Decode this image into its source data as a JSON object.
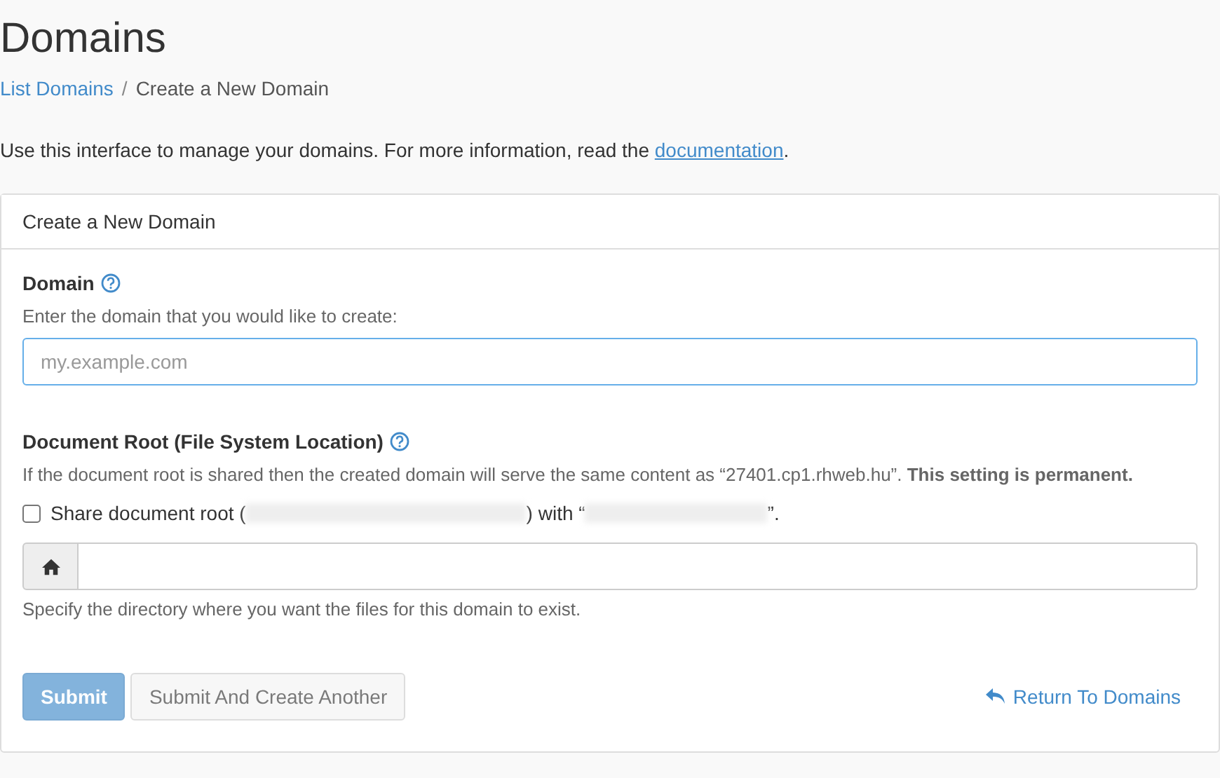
{
  "page": {
    "title": "Domains"
  },
  "breadcrumb_separator": "/",
  "breadcrumb": [
    {
      "label": "List Domains",
      "link": true
    },
    {
      "label": "Create a New Domain",
      "link": false
    }
  ],
  "intro": {
    "text": "Use this interface to manage your domains. For more information, read the ",
    "link": "documentation",
    "end": "."
  },
  "card": {
    "title": "Create a New Domain"
  },
  "domain_field": {
    "label": "Domain",
    "help": "Enter the domain that you would like to create:",
    "placeholder": "my.example.com",
    "focused": true
  },
  "docroot": {
    "label": "Document Root (File System Location)",
    "help": "If the document root is shared then the created domain will serve the same content as “27401.cp1.rhweb.hu”. **This setting is permanent.**",
    "share": {
      "checked": false,
      "parts": [
        "Share document root (",
        ") with “",
        "”."
      ]
    },
    "note": "Specify the directory where you want the files for this domain to exist."
  },
  "buttons": [
    {
      "label": "Submit",
      "kind": "primary",
      "disabled": true
    },
    {
      "label": "Submit And Create Another",
      "kind": "default",
      "disabled": true
    }
  ],
  "return_link": "Return To Domains"
}
